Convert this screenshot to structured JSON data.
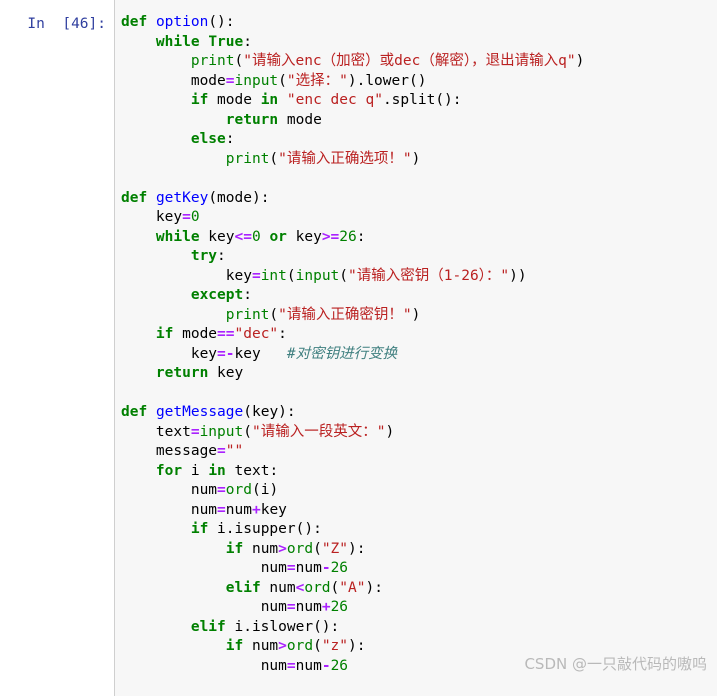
{
  "cell": {
    "prompt_label": "In  [46]:",
    "prompt_color": "#303f9f",
    "background": "#f7f7f7",
    "border_color": "#cfcfcf"
  },
  "watermark": {
    "text": "CSDN @一只敲代码的嗷呜",
    "color": "#b9b9b9"
  },
  "syntax_colors": {
    "keyword": "#008000",
    "function_name": "#0000ff",
    "builtin": "#008000",
    "string": "#ba2121",
    "number": "#008000",
    "operator": "#aa22ff",
    "comment": "#408080",
    "plain": "#000000"
  },
  "code": {
    "language": "python",
    "lines": [
      {
        "n": 1,
        "indent": 0,
        "tokens": [
          {
            "t": "def",
            "c": "kw"
          },
          {
            "t": " ",
            "c": "plain"
          },
          {
            "t": "option",
            "c": "fn"
          },
          {
            "t": "():",
            "c": "plain"
          }
        ]
      },
      {
        "n": 2,
        "indent": 1,
        "tokens": [
          {
            "t": "while",
            "c": "kw"
          },
          {
            "t": " ",
            "c": "plain"
          },
          {
            "t": "True",
            "c": "kw"
          },
          {
            "t": ":",
            "c": "plain"
          }
        ]
      },
      {
        "n": 3,
        "indent": 2,
        "tokens": [
          {
            "t": "print",
            "c": "builtin"
          },
          {
            "t": "(",
            "c": "plain"
          },
          {
            "t": "\"请输入enc（加密）或dec（解密），退出请输入q\"",
            "c": "str"
          },
          {
            "t": ")",
            "c": "plain"
          }
        ]
      },
      {
        "n": 4,
        "indent": 2,
        "tokens": [
          {
            "t": "mode",
            "c": "plain"
          },
          {
            "t": "=",
            "c": "op"
          },
          {
            "t": "input",
            "c": "builtin"
          },
          {
            "t": "(",
            "c": "plain"
          },
          {
            "t": "\"选择：\"",
            "c": "str"
          },
          {
            "t": ").lower()",
            "c": "plain"
          }
        ]
      },
      {
        "n": 5,
        "indent": 2,
        "tokens": [
          {
            "t": "if",
            "c": "kw"
          },
          {
            "t": " mode ",
            "c": "plain"
          },
          {
            "t": "in",
            "c": "kw"
          },
          {
            "t": " ",
            "c": "plain"
          },
          {
            "t": "\"enc dec q\"",
            "c": "str"
          },
          {
            "t": ".split():",
            "c": "plain"
          }
        ]
      },
      {
        "n": 6,
        "indent": 3,
        "tokens": [
          {
            "t": "return",
            "c": "kw"
          },
          {
            "t": " mode",
            "c": "plain"
          }
        ]
      },
      {
        "n": 7,
        "indent": 2,
        "tokens": [
          {
            "t": "else",
            "c": "kw"
          },
          {
            "t": ":",
            "c": "plain"
          }
        ]
      },
      {
        "n": 8,
        "indent": 3,
        "tokens": [
          {
            "t": "print",
            "c": "builtin"
          },
          {
            "t": "(",
            "c": "plain"
          },
          {
            "t": "\"请输入正确选项！\"",
            "c": "str"
          },
          {
            "t": ")",
            "c": "plain"
          }
        ]
      },
      {
        "n": 9,
        "indent": 0,
        "tokens": []
      },
      {
        "n": 10,
        "indent": 0,
        "tokens": [
          {
            "t": "def",
            "c": "kw"
          },
          {
            "t": " ",
            "c": "plain"
          },
          {
            "t": "getKey",
            "c": "fn"
          },
          {
            "t": "(mode):",
            "c": "plain"
          }
        ]
      },
      {
        "n": 11,
        "indent": 1,
        "tokens": [
          {
            "t": "key",
            "c": "plain"
          },
          {
            "t": "=",
            "c": "op"
          },
          {
            "t": "0",
            "c": "num"
          }
        ]
      },
      {
        "n": 12,
        "indent": 1,
        "tokens": [
          {
            "t": "while",
            "c": "kw"
          },
          {
            "t": " key",
            "c": "plain"
          },
          {
            "t": "<=",
            "c": "op"
          },
          {
            "t": "0",
            "c": "num"
          },
          {
            "t": " ",
            "c": "plain"
          },
          {
            "t": "or",
            "c": "kw"
          },
          {
            "t": " key",
            "c": "plain"
          },
          {
            "t": ">=",
            "c": "op"
          },
          {
            "t": "26",
            "c": "num"
          },
          {
            "t": ":",
            "c": "plain"
          }
        ]
      },
      {
        "n": 13,
        "indent": 2,
        "tokens": [
          {
            "t": "try",
            "c": "kw"
          },
          {
            "t": ":",
            "c": "plain"
          }
        ]
      },
      {
        "n": 14,
        "indent": 3,
        "tokens": [
          {
            "t": "key",
            "c": "plain"
          },
          {
            "t": "=",
            "c": "op"
          },
          {
            "t": "int",
            "c": "builtin"
          },
          {
            "t": "(",
            "c": "plain"
          },
          {
            "t": "input",
            "c": "builtin"
          },
          {
            "t": "(",
            "c": "plain"
          },
          {
            "t": "\"请输入密钥（1-26）：\"",
            "c": "str"
          },
          {
            "t": "))",
            "c": "plain"
          }
        ]
      },
      {
        "n": 15,
        "indent": 2,
        "tokens": [
          {
            "t": "except",
            "c": "kw"
          },
          {
            "t": ":",
            "c": "plain"
          }
        ]
      },
      {
        "n": 16,
        "indent": 3,
        "tokens": [
          {
            "t": "print",
            "c": "builtin"
          },
          {
            "t": "(",
            "c": "plain"
          },
          {
            "t": "\"请输入正确密钥！\"",
            "c": "str"
          },
          {
            "t": ")",
            "c": "plain"
          }
        ]
      },
      {
        "n": 17,
        "indent": 1,
        "tokens": [
          {
            "t": "if",
            "c": "kw"
          },
          {
            "t": " mode",
            "c": "plain"
          },
          {
            "t": "==",
            "c": "op"
          },
          {
            "t": "\"dec\"",
            "c": "str"
          },
          {
            "t": ":",
            "c": "plain"
          }
        ]
      },
      {
        "n": 18,
        "indent": 2,
        "tokens": [
          {
            "t": "key",
            "c": "plain"
          },
          {
            "t": "=-",
            "c": "op"
          },
          {
            "t": "key",
            "c": "plain"
          },
          {
            "t": "   ",
            "c": "plain"
          },
          {
            "t": "#对密钥进行变换",
            "c": "cmt"
          }
        ]
      },
      {
        "n": 19,
        "indent": 1,
        "tokens": [
          {
            "t": "return",
            "c": "kw"
          },
          {
            "t": " key",
            "c": "plain"
          }
        ]
      },
      {
        "n": 20,
        "indent": 0,
        "tokens": []
      },
      {
        "n": 21,
        "indent": 0,
        "tokens": [
          {
            "t": "def",
            "c": "kw"
          },
          {
            "t": " ",
            "c": "plain"
          },
          {
            "t": "getMessage",
            "c": "fn"
          },
          {
            "t": "(key):",
            "c": "plain"
          }
        ]
      },
      {
        "n": 22,
        "indent": 1,
        "tokens": [
          {
            "t": "text",
            "c": "plain"
          },
          {
            "t": "=",
            "c": "op"
          },
          {
            "t": "input",
            "c": "builtin"
          },
          {
            "t": "(",
            "c": "plain"
          },
          {
            "t": "\"请输入一段英文：\"",
            "c": "str"
          },
          {
            "t": ")",
            "c": "plain"
          }
        ]
      },
      {
        "n": 23,
        "indent": 1,
        "tokens": [
          {
            "t": "message",
            "c": "plain"
          },
          {
            "t": "=",
            "c": "op"
          },
          {
            "t": "\"\"",
            "c": "str"
          }
        ]
      },
      {
        "n": 24,
        "indent": 1,
        "tokens": [
          {
            "t": "for",
            "c": "kw"
          },
          {
            "t": " i ",
            "c": "plain"
          },
          {
            "t": "in",
            "c": "kw"
          },
          {
            "t": " text:",
            "c": "plain"
          }
        ]
      },
      {
        "n": 25,
        "indent": 2,
        "tokens": [
          {
            "t": "num",
            "c": "plain"
          },
          {
            "t": "=",
            "c": "op"
          },
          {
            "t": "ord",
            "c": "builtin"
          },
          {
            "t": "(i)",
            "c": "plain"
          }
        ]
      },
      {
        "n": 26,
        "indent": 2,
        "tokens": [
          {
            "t": "num",
            "c": "plain"
          },
          {
            "t": "=",
            "c": "op"
          },
          {
            "t": "num",
            "c": "plain"
          },
          {
            "t": "+",
            "c": "op"
          },
          {
            "t": "key",
            "c": "plain"
          }
        ]
      },
      {
        "n": 27,
        "indent": 2,
        "tokens": [
          {
            "t": "if",
            "c": "kw"
          },
          {
            "t": " i.isupper():",
            "c": "plain"
          }
        ]
      },
      {
        "n": 28,
        "indent": 3,
        "tokens": [
          {
            "t": "if",
            "c": "kw"
          },
          {
            "t": " num",
            "c": "plain"
          },
          {
            "t": ">",
            "c": "op"
          },
          {
            "t": "ord",
            "c": "builtin"
          },
          {
            "t": "(",
            "c": "plain"
          },
          {
            "t": "\"Z\"",
            "c": "str"
          },
          {
            "t": "):",
            "c": "plain"
          }
        ]
      },
      {
        "n": 29,
        "indent": 4,
        "tokens": [
          {
            "t": "num",
            "c": "plain"
          },
          {
            "t": "=",
            "c": "op"
          },
          {
            "t": "num",
            "c": "plain"
          },
          {
            "t": "-",
            "c": "op"
          },
          {
            "t": "26",
            "c": "num"
          }
        ]
      },
      {
        "n": 30,
        "indent": 3,
        "tokens": [
          {
            "t": "elif",
            "c": "kw"
          },
          {
            "t": " num",
            "c": "plain"
          },
          {
            "t": "<",
            "c": "op"
          },
          {
            "t": "ord",
            "c": "builtin"
          },
          {
            "t": "(",
            "c": "plain"
          },
          {
            "t": "\"A\"",
            "c": "str"
          },
          {
            "t": "):",
            "c": "plain"
          }
        ]
      },
      {
        "n": 31,
        "indent": 4,
        "tokens": [
          {
            "t": "num",
            "c": "plain"
          },
          {
            "t": "=",
            "c": "op"
          },
          {
            "t": "num",
            "c": "plain"
          },
          {
            "t": "+",
            "c": "op"
          },
          {
            "t": "26",
            "c": "num"
          }
        ]
      },
      {
        "n": 32,
        "indent": 2,
        "tokens": [
          {
            "t": "elif",
            "c": "kw"
          },
          {
            "t": " i.islower():",
            "c": "plain"
          }
        ]
      },
      {
        "n": 33,
        "indent": 3,
        "tokens": [
          {
            "t": "if",
            "c": "kw"
          },
          {
            "t": " num",
            "c": "plain"
          },
          {
            "t": ">",
            "c": "op"
          },
          {
            "t": "ord",
            "c": "builtin"
          },
          {
            "t": "(",
            "c": "plain"
          },
          {
            "t": "\"z\"",
            "c": "str"
          },
          {
            "t": "):",
            "c": "plain"
          }
        ]
      },
      {
        "n": 34,
        "indent": 4,
        "tokens": [
          {
            "t": "num",
            "c": "plain"
          },
          {
            "t": "=",
            "c": "op"
          },
          {
            "t": "num",
            "c": "plain"
          },
          {
            "t": "-",
            "c": "op"
          },
          {
            "t": "26",
            "c": "num"
          }
        ]
      }
    ]
  }
}
